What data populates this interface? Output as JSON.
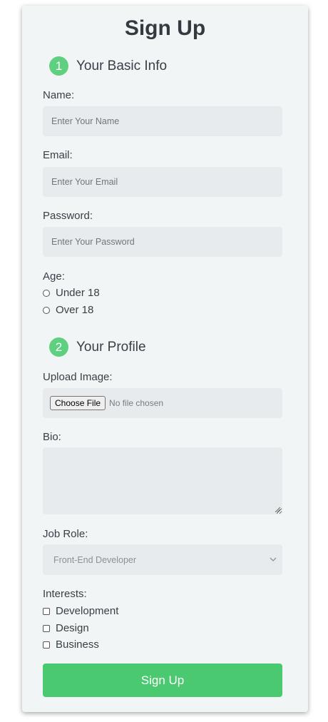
{
  "title": "Sign Up",
  "section1": {
    "number": "1",
    "title": "Your Basic Info"
  },
  "name": {
    "label": "Name:",
    "placeholder": "Enter Your Name"
  },
  "email": {
    "label": "Email:",
    "placeholder": "Enter Your Email"
  },
  "password": {
    "label": "Password:",
    "placeholder": "Enter Your Password"
  },
  "age": {
    "label": "Age:",
    "options": [
      "Under 18",
      "Over 18"
    ]
  },
  "section2": {
    "number": "2",
    "title": "Your Profile"
  },
  "upload": {
    "label": "Upload Image:",
    "button": "Choose File",
    "status": "No file chosen"
  },
  "bio": {
    "label": "Bio:"
  },
  "job_role": {
    "label": "Job Role:",
    "selected": "Front-End Developer"
  },
  "interests": {
    "label": "Interests:",
    "options": [
      "Development",
      "Design",
      "Business"
    ]
  },
  "submit_label": "Sign Up",
  "colors": {
    "accent": "#4bc970",
    "card_bg": "#f2f5f6",
    "field_bg": "#e8ebed"
  }
}
